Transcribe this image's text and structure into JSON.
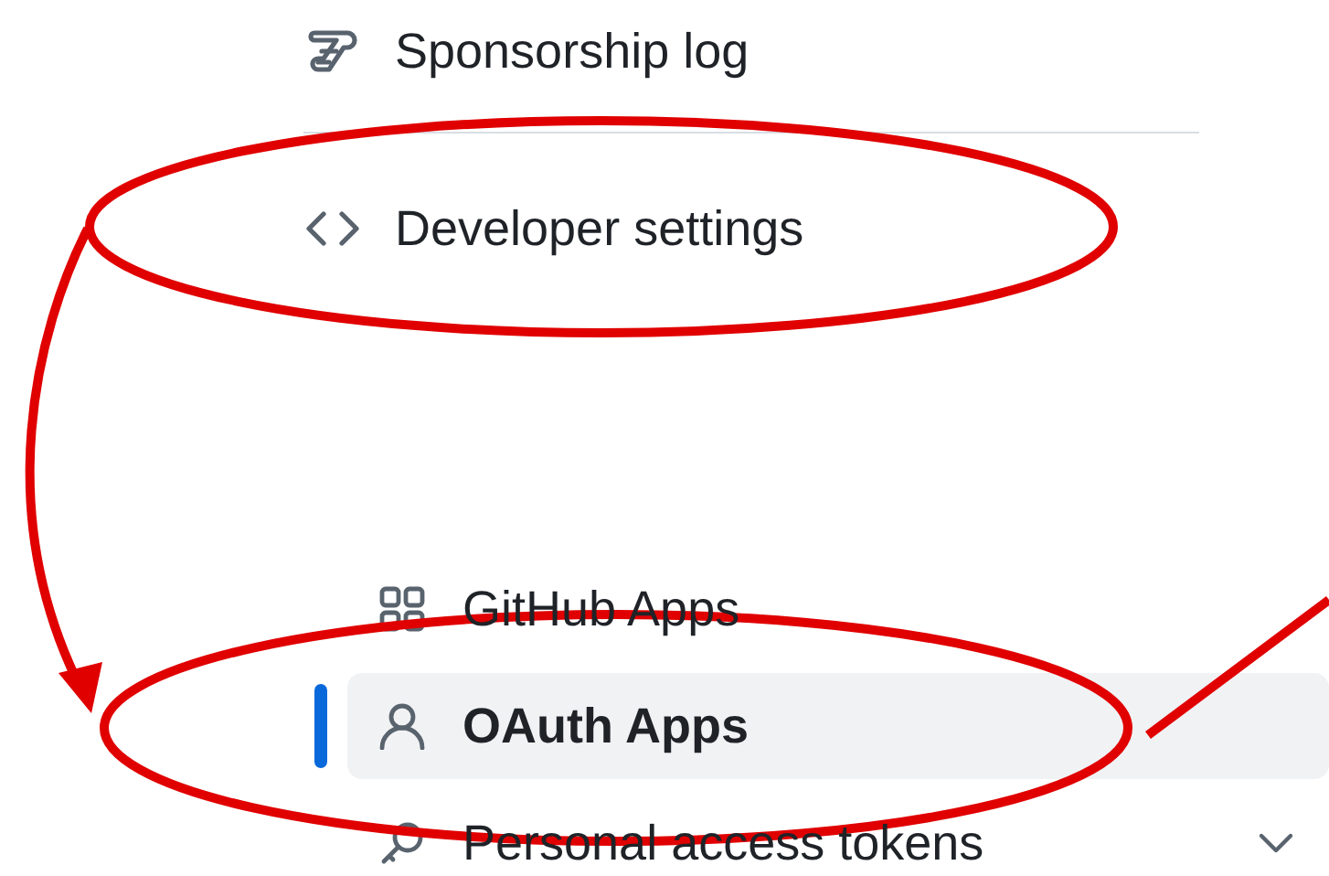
{
  "settings_menu": [
    {
      "label": "Sponsorship log"
    },
    {
      "label": "Developer settings"
    }
  ],
  "developer_menu": [
    {
      "label": "GitHub Apps",
      "selected": false
    },
    {
      "label": "OAuth Apps",
      "selected": true
    },
    {
      "label": "Personal access tokens",
      "selected": false,
      "expanded": false
    }
  ]
}
